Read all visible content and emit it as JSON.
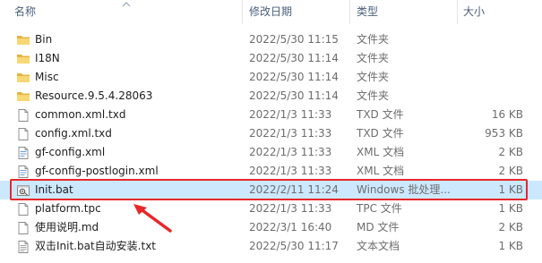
{
  "columns": {
    "name": "名称",
    "date": "修改日期",
    "type": "类型",
    "size": "大小"
  },
  "files": [
    {
      "name": "Bin",
      "date": "2022/5/30 11:15",
      "type": "文件夹",
      "size": "",
      "icon": "folder-icon"
    },
    {
      "name": "I18N",
      "date": "2022/5/30 11:14",
      "type": "文件夹",
      "size": "",
      "icon": "folder-icon"
    },
    {
      "name": "Misc",
      "date": "2022/5/30 11:14",
      "type": "文件夹",
      "size": "",
      "icon": "folder-icon"
    },
    {
      "name": "Resource.9.5.4.28063",
      "date": "2022/5/30 11:14",
      "type": "文件夹",
      "size": "",
      "icon": "folder-icon"
    },
    {
      "name": "common.xml.txd",
      "date": "2022/1/3 11:33",
      "type": "TXD 文件",
      "size": "16 KB",
      "icon": "file-icon"
    },
    {
      "name": "config.xml.txd",
      "date": "2022/1/3 11:33",
      "type": "TXD 文件",
      "size": "953 KB",
      "icon": "file-icon"
    },
    {
      "name": "gf-config.xml",
      "date": "2022/1/3 11:33",
      "type": "XML 文档",
      "size": "2 KB",
      "icon": "xml-file-icon"
    },
    {
      "name": "gf-config-postlogin.xml",
      "date": "2022/1/3 11:33",
      "type": "XML 文档",
      "size": "2 KB",
      "icon": "xml-file-icon"
    },
    {
      "name": "Init.bat",
      "date": "2022/2/11 11:24",
      "type": "Windows 批处理...",
      "size": "1 KB",
      "icon": "batch-file-icon"
    },
    {
      "name": "platform.tpc",
      "date": "2022/1/3 11:33",
      "type": "TPC 文件",
      "size": "1 KB",
      "icon": "file-icon"
    },
    {
      "name": "使用说明.md",
      "date": "2022/3/1 16:40",
      "type": "MD 文件",
      "size": "2 KB",
      "icon": "file-icon"
    },
    {
      "name": "双击Init.bat自动安装.txt",
      "date": "2022/5/30 11:17",
      "type": "文本文档",
      "size": "1 KB",
      "icon": "text-file-icon"
    }
  ],
  "selected_index": 8,
  "colors": {
    "highlight": "#e8272a",
    "selection": "#cce8ff",
    "folder": "#f5c84c"
  }
}
